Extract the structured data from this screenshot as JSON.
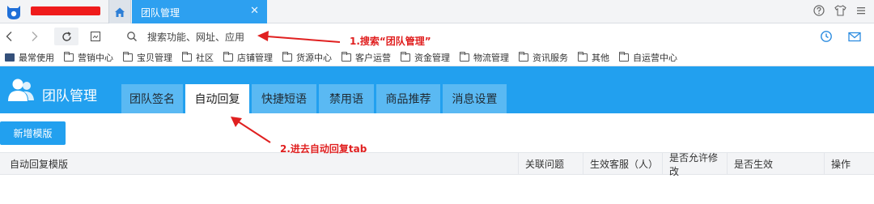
{
  "browser": {
    "active_tab_label": "团队管理",
    "close_glyph": "✕",
    "address_placeholder": "搜索功能、网址、应用"
  },
  "bookmarks": [
    {
      "label": "最常使用",
      "icon": "favorites-icon"
    },
    {
      "label": "营销中心",
      "icon": "folder-icon"
    },
    {
      "label": "宝贝管理",
      "icon": "folder-icon"
    },
    {
      "label": "社区",
      "icon": "folder-icon"
    },
    {
      "label": "店铺管理",
      "icon": "folder-icon"
    },
    {
      "label": "货源中心",
      "icon": "folder-icon"
    },
    {
      "label": "客户运营",
      "icon": "folder-icon"
    },
    {
      "label": "资金管理",
      "icon": "folder-icon"
    },
    {
      "label": "物流管理",
      "icon": "folder-icon"
    },
    {
      "label": "资讯服务",
      "icon": "folder-icon"
    },
    {
      "label": "其他",
      "icon": "folder-icon"
    },
    {
      "label": "自运营中心",
      "icon": "folder-icon"
    }
  ],
  "app": {
    "title": "团队管理",
    "tabs": [
      "团队签名",
      "自动回复",
      "快捷短语",
      "禁用语",
      "商品推荐",
      "消息设置"
    ],
    "active_tab_index": 1,
    "new_template_button": "新增模版",
    "table_headers": [
      "自动回复模版",
      "关联问题",
      "生效客服（人）",
      "是否允许修改",
      "是否生效",
      "操作"
    ]
  },
  "annotations": {
    "step1": "1.搜索“团队管理”",
    "step2": "2.进去自动回复tab"
  },
  "colors": {
    "brand_blue": "#22a0ef",
    "annotation_red": "#e02020"
  }
}
